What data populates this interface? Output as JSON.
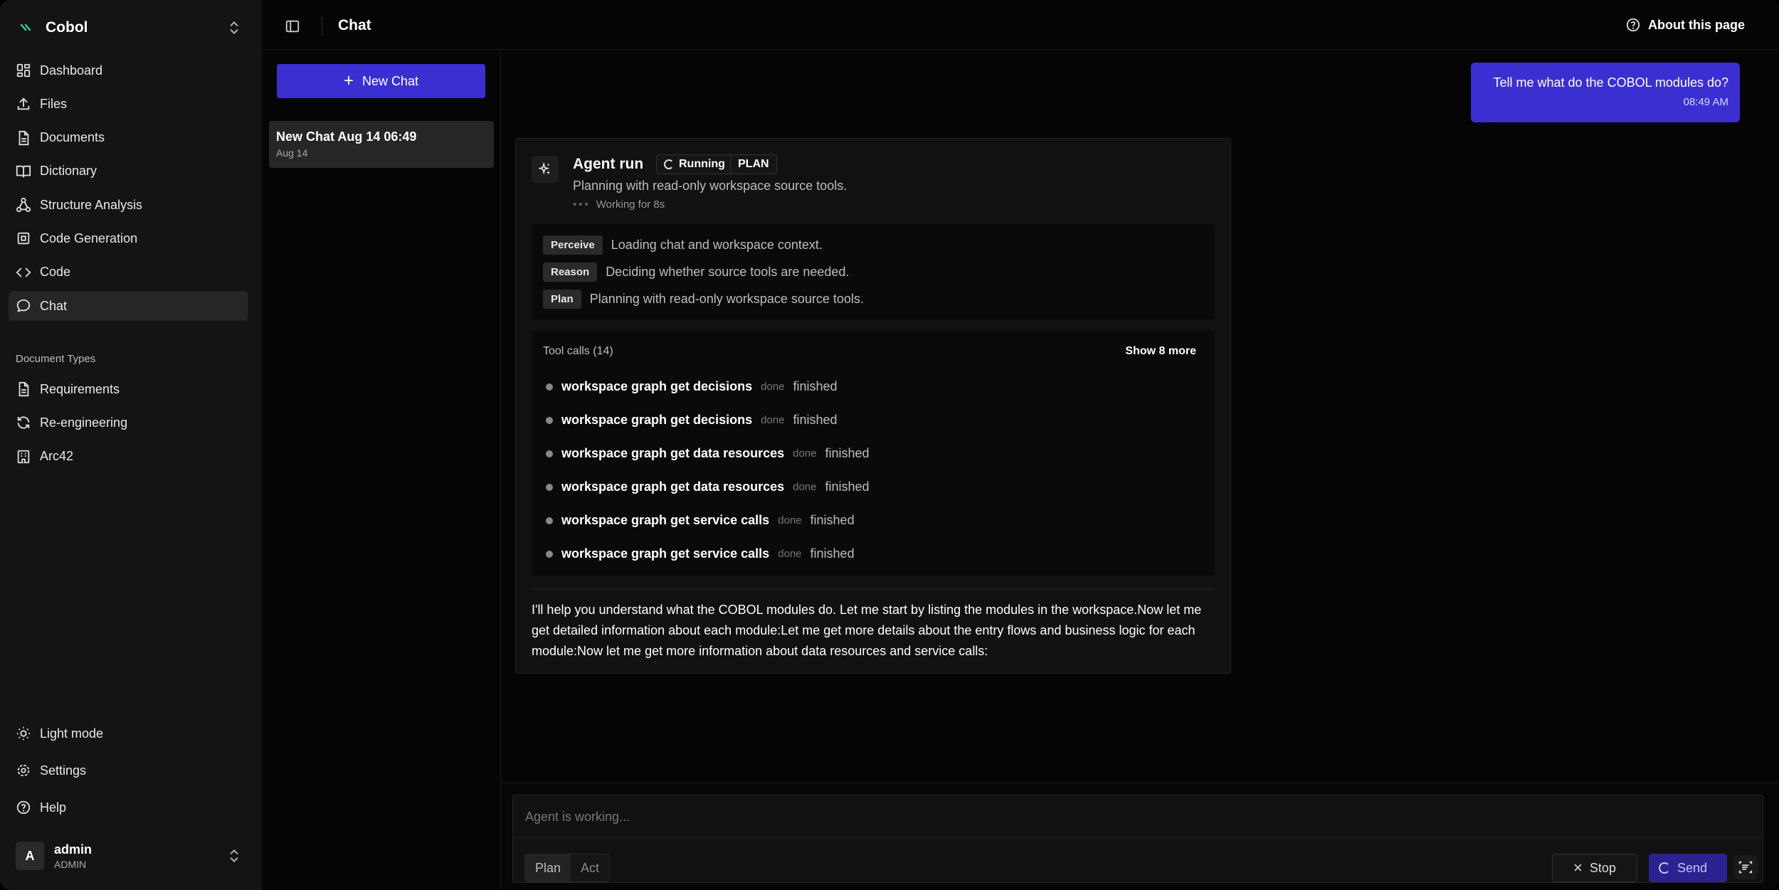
{
  "sidebar": {
    "brand": "Cobol",
    "items": [
      {
        "label": "Dashboard",
        "icon": "dashboard-icon"
      },
      {
        "label": "Files",
        "icon": "upload-icon"
      },
      {
        "label": "Documents",
        "icon": "document-icon"
      },
      {
        "label": "Dictionary",
        "icon": "book-icon"
      },
      {
        "label": "Structure Analysis",
        "icon": "network-icon"
      },
      {
        "label": "Code Generation",
        "icon": "chip-icon"
      },
      {
        "label": "Code",
        "icon": "code-icon"
      },
      {
        "label": "Chat",
        "icon": "chat-icon"
      }
    ],
    "section_label": "Document Types",
    "doc_types": [
      {
        "label": "Requirements",
        "icon": "document-icon"
      },
      {
        "label": "Re-engineering",
        "icon": "refresh-icon"
      },
      {
        "label": "Arc42",
        "icon": "building-icon"
      }
    ],
    "bottom": [
      {
        "label": "Light mode",
        "icon": "sun-icon"
      },
      {
        "label": "Settings",
        "icon": "gear-icon"
      },
      {
        "label": "Help",
        "icon": "help-icon"
      }
    ],
    "user": {
      "initial": "A",
      "name": "admin",
      "role": "ADMIN"
    }
  },
  "header": {
    "title": "Chat",
    "about": "About this page"
  },
  "chatlist": {
    "new_chat": "New Chat",
    "items": [
      {
        "title": "New Chat Aug 14 06:49",
        "date": "Aug 14"
      }
    ]
  },
  "conversation": {
    "user_message": {
      "text": "Tell me what do the COBOL modules do?",
      "time": "08:49 AM"
    },
    "agent": {
      "title": "Agent run",
      "status": "Running",
      "mode": "PLAN",
      "subtitle": "Planning with read-only workspace source tools.",
      "working": "Working for 8s",
      "phases": [
        {
          "tag": "Perceive",
          "text": "Loading chat and workspace context."
        },
        {
          "tag": "Reason",
          "text": "Deciding whether source tools are needed."
        },
        {
          "tag": "Plan",
          "text": "Planning with read-only workspace source tools."
        }
      ],
      "tools_title": "Tool calls (14)",
      "tools_more": "Show 8 more",
      "tools": [
        {
          "name": "workspace graph get decisions",
          "status": "done",
          "result": "finished"
        },
        {
          "name": "workspace graph get decisions",
          "status": "done",
          "result": "finished"
        },
        {
          "name": "workspace graph get data resources",
          "status": "done",
          "result": "finished"
        },
        {
          "name": "workspace graph get data resources",
          "status": "done",
          "result": "finished"
        },
        {
          "name": "workspace graph get service calls",
          "status": "done",
          "result": "finished"
        },
        {
          "name": "workspace graph get service calls",
          "status": "done",
          "result": "finished"
        }
      ],
      "response": "I'll help you understand what the COBOL modules do. Let me start by listing the modules in the workspace.Now let me get detailed information about each module:Let me get more details about the entry flows and business logic for each module:Now let me get more information about data resources and service calls:"
    }
  },
  "composer": {
    "placeholder": "Agent is working...",
    "modes": [
      "Plan",
      "Act"
    ],
    "selected_mode": "Plan",
    "stop": "Stop",
    "send": "Send"
  },
  "colors": {
    "accent": "#3b2fd1",
    "background": "#050505",
    "sidebar": "#141414"
  }
}
